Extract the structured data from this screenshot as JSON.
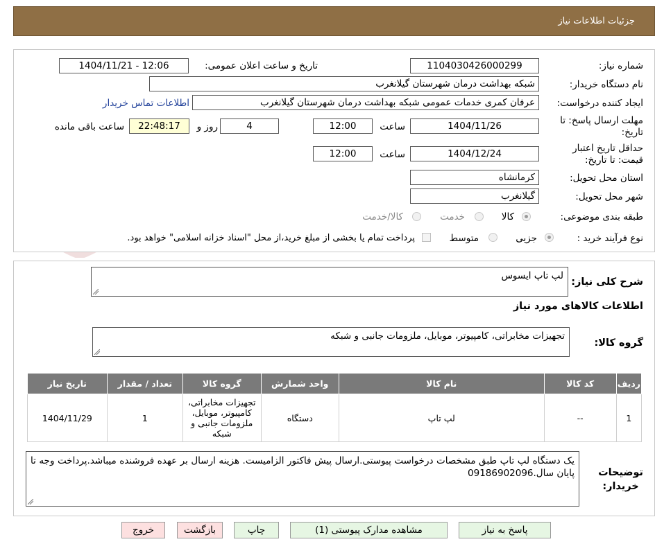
{
  "header": {
    "title": "جزئیات اطلاعات نیاز"
  },
  "form": {
    "need_number_label": "شماره نیاز:",
    "need_number": "1104030426000299",
    "announce_label": "تاریخ و ساعت اعلان عمومی:",
    "announce_value": "1404/11/21 - 12:06",
    "buyer_org_label": "نام دستگاه خریدار:",
    "buyer_org": "شبکه بهداشت درمان شهرستان گیلانغرب",
    "creator_label": "ایجاد کننده درخواست:",
    "creator": "عرفان کمری خدمات عمومی شبکه بهداشت درمان شهرستان گیلانغرب",
    "contact_link": "اطلاعات تماس خریدار",
    "deadline_label_1": "مهلت ارسال پاسخ: تا",
    "deadline_label_2": "تاریخ:",
    "deadline_date": "1404/11/26",
    "time_label": "ساعت",
    "deadline_time": "12:00",
    "days_value": "4",
    "days_label": "روز و",
    "remaining_time": "22:48:17",
    "remaining_label": "ساعت باقی مانده",
    "validity_label_1": "حداقل تاریخ اعتبار",
    "validity_label_2": "قیمت: تا تاریخ:",
    "validity_date": "1404/12/24",
    "validity_time": "12:00",
    "province_label": "استان محل تحویل:",
    "province": "کرمانشاه",
    "city_label": "شهر محل تحویل:",
    "city": "گیلانغرب",
    "category_label": "طبقه بندی موضوعی:",
    "category_options": [
      "کالا",
      "خدمت",
      "کالا/خدمت"
    ],
    "process_label": "نوع فرآیند خرید :",
    "process_options": [
      "جزیی",
      "متوسط"
    ],
    "payment_note": "پرداخت تمام یا بخشی از مبلغ خرید،از محل \"اسناد خزانه اسلامی\" خواهد بود."
  },
  "summary": {
    "label": "شرح کلی نیاز:",
    "value": "لپ تاپ ایسوس"
  },
  "goods_info": {
    "title": "اطلاعات کالاهای مورد نیاز",
    "group_label": "گروه کالا:",
    "group_value": "تجهیزات مخابراتی، کامپیوتر، موبایل، ملزومات جانبی و شبکه"
  },
  "table": {
    "headers": [
      "ردیف",
      "کد کالا",
      "نام کالا",
      "واحد شمارش",
      "گروه کالا",
      "تعداد / مقدار",
      "تاریخ نیاز"
    ],
    "rows": [
      [
        "1",
        "--",
        "لپ تاپ",
        "دستگاه",
        "تجهیزات مخابراتی، کامپیوتر، موبایل، ملزومات جانبی و شبکه",
        "1",
        "1404/11/29"
      ]
    ]
  },
  "notes": {
    "label_1": "توضیحات",
    "label_2": "خریدار:",
    "text": "یک دستگاه لپ تاپ طبق مشخصات درخواست پیوستی.ارسال پیش فاکتور الزامیست. هزینه ارسال بر عهده فروشنده میباشد.پرداخت وجه تا پایان سال.09186902096"
  },
  "buttons": {
    "reply": "پاسخ به نیاز",
    "attachments": "مشاهده مدارک پیوستی (1)",
    "print": "چاپ",
    "back": "بازگشت",
    "exit": "خروج"
  },
  "colors": {
    "header_bg": "#8f6f45",
    "table_header_bg": "#7a7a7a",
    "button_green": "#e6f6e3",
    "button_pink": "#fde0e0",
    "remaining_bg": "#ffffd6",
    "link": "#1f3f99"
  }
}
